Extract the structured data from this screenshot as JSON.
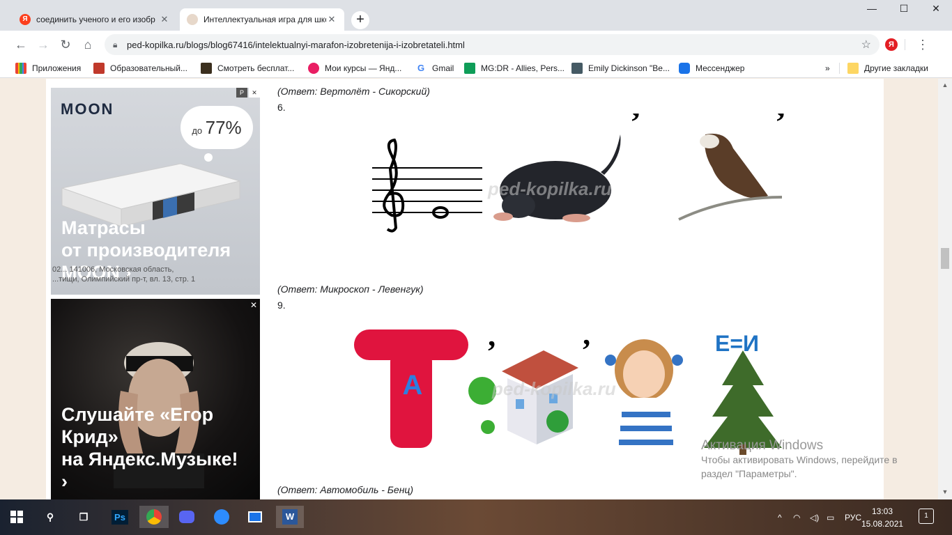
{
  "browser": {
    "tabs": [
      {
        "title": "соединить ученого и его изобр",
        "favicon_color": "#fc3f1d",
        "active": false
      },
      {
        "title": "Интеллектуальная игра для школ",
        "favicon_color": "#e7d8ca",
        "active": true
      }
    ],
    "new_tab": "+",
    "window_controls": {
      "minimize": "—",
      "maximize": "☐",
      "close": "✕"
    },
    "url": "ped-kopilka.ru/blogs/blog67416/intelektualnyi-marafon-izobretenija-i-izobretateli.html",
    "bookmarks": [
      {
        "label": "Приложения",
        "color": "#4285f4"
      },
      {
        "label": "Образовательный...",
        "color": "#c0392b"
      },
      {
        "label": "Смотреть бесплат...",
        "color": "#3b2f1e"
      },
      {
        "label": "Мои курсы — Янд...",
        "color": "#e91e63"
      },
      {
        "label": "Gmail",
        "color": "#4285f4"
      },
      {
        "label": "MG:DR - Allies, Pers...",
        "color": "#0f9d58"
      },
      {
        "label": "Emily Dickinson \"Be...",
        "color": "#455a64"
      },
      {
        "label": "Мессенджер",
        "color": "#1a73e8"
      }
    ],
    "more_bookmarks": "»",
    "other_bookmarks": "Другие закладки"
  },
  "ads": {
    "ad1": {
      "brand": "MOON",
      "discount_prefix": "до",
      "discount": "77%",
      "headline_line1": "Матрасы",
      "headline_line2": "от производителя",
      "headline_line3": "MOON ›",
      "legal_line1": "02... 141006, Московская область,",
      "legal_line2": "...тищи, Олимпийский пр-т, вл. 13, стр. 1",
      "badge": "P",
      "close": "✕"
    },
    "ad2": {
      "headline_line1": "Слушайте «Егор",
      "headline_line2": "Крид»",
      "headline_line3": "на Яндекс.Музыке!",
      "headline_line4": "›",
      "close": "✕"
    }
  },
  "article": {
    "answer_5": "(Ответ: Вертолёт - Сикорский)",
    "q6": "6.",
    "answer_6": "(Ответ: Микроскоп - Левенгук)",
    "q9": "9.",
    "answer_9": "(Ответ: Автомобиль - Бенц)",
    "watermark": "ped-kopilka.ru",
    "rebus_letter_t": "Т",
    "rebus_letter_a": "А",
    "rebus_equation": "Е=И",
    "comma": "’"
  },
  "activation": {
    "title": "Активация Windows",
    "line1": "Чтобы активировать Windows, перейдите в",
    "line2": "раздел \"Параметры\"."
  },
  "taskbar": {
    "language": "РУС",
    "time": "13:03",
    "date": "15.08.2021",
    "notifications": "1"
  }
}
